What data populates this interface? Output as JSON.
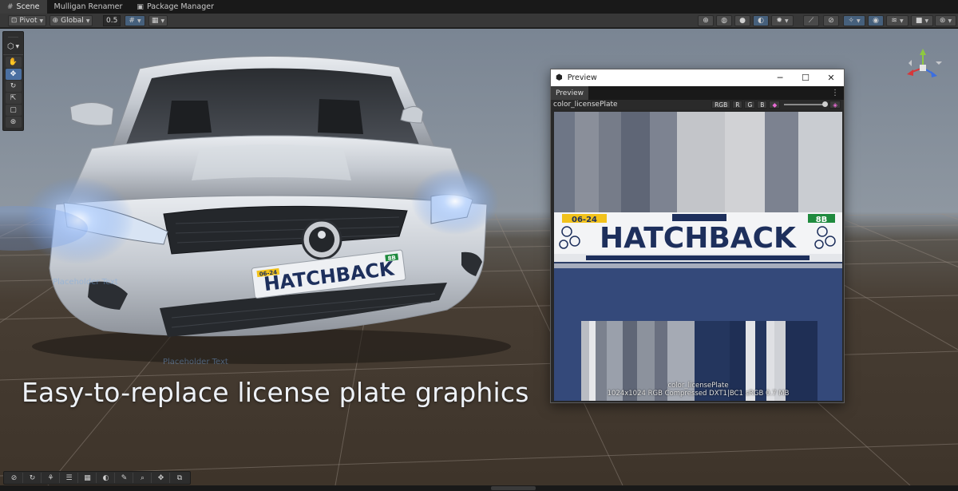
{
  "tabs": [
    {
      "label": "Scene",
      "icon": "scene-icon",
      "active": true
    },
    {
      "label": "Mulligan Renamer",
      "icon": "",
      "active": false
    },
    {
      "label": "Package Manager",
      "icon": "package-icon",
      "active": false
    }
  ],
  "toolbar": {
    "pivot_label": "Pivot",
    "global_label": "Global",
    "snap_value": "0.5"
  },
  "caption": "Easy-to-replace license plate graphics",
  "plate": {
    "date": "06-24",
    "badge": "8B",
    "text": "HATCHBACK"
  },
  "ghost_labels": {
    "left": "Placeholder Text",
    "bottom": "Placeholder Text"
  },
  "preview": {
    "window_title": "Preview",
    "tab_label": "Preview",
    "asset_name": "color_licensePlate",
    "channels": [
      "RGB",
      "R",
      "G",
      "B"
    ],
    "info_name": "color_licensePlate",
    "info_detail": "1024x1024  RGB Compressed DXT1|BC1 sRGB  0.7 MB"
  },
  "colors": {
    "accent_blue": "#4a6fa1",
    "plate_navy": "#1d2f5c",
    "plate_yellow": "#f2c21b",
    "plate_green": "#1f8a3e",
    "texture_navy": "#2c3e66"
  }
}
